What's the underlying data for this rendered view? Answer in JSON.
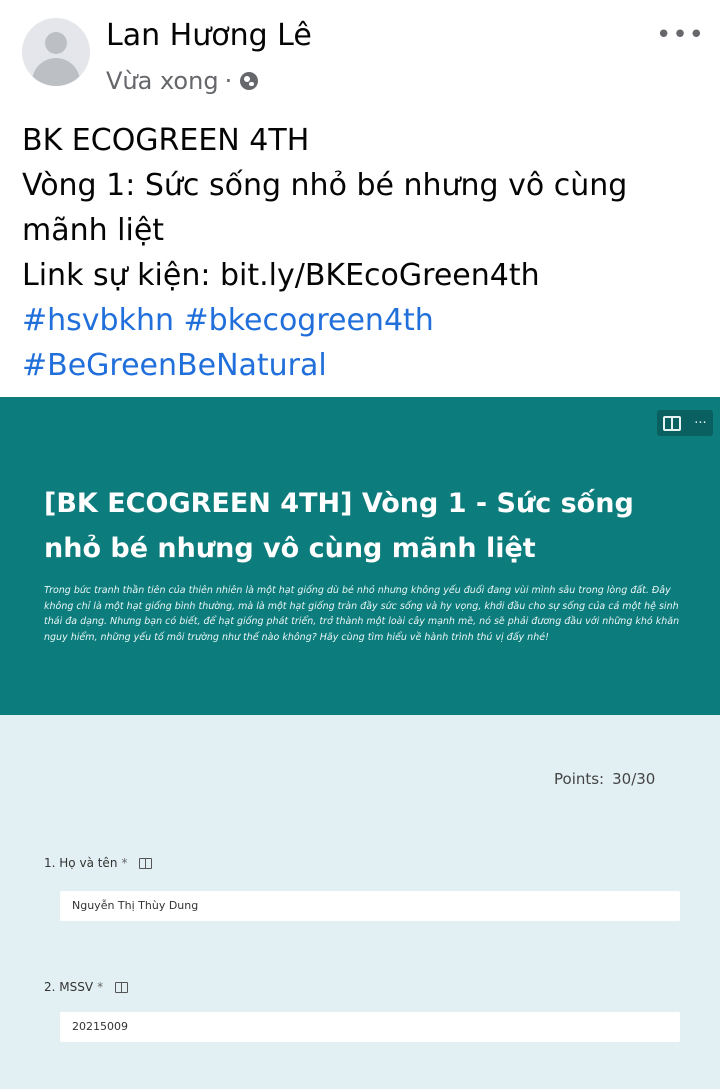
{
  "post": {
    "author": "Lan Hương Lê",
    "time": "Vừa xong",
    "separator": "·",
    "privacy_icon": "globe-icon",
    "more_icon": "ellipsis-icon",
    "more_label": "•••",
    "text_lines": [
      "BK ECOGREEN 4TH",
      "Vòng 1: Sức sống nhỏ bé nhưng vô cùng mãnh liệt",
      "Link sự kiện: bit.ly/BKEcoGreen4th"
    ],
    "hashtags_line1": "#hsvbkhn #bkecogreen4th",
    "hashtags_line2": "#BeGreenBeNatural",
    "hashtag_color": "#216fdb"
  },
  "form": {
    "banner_color": "#0d7c7c",
    "toolbar": {
      "reader_icon": "immersive-reader-icon",
      "more_label": "···"
    },
    "title": "[BK ECOGREEN 4TH] Vòng 1 - Sức sống nhỏ bé nhưng vô cùng mãnh liệt",
    "description": "Trong bức tranh thần tiên của thiên nhiên là một hạt giống dù bé nhỏ nhưng không yếu đuối đang vùi mình sâu trong lòng đất. Đây không chỉ là một hạt giống bình thường, mà là một hạt giống tràn đầy sức sống và hy vọng, khởi đầu cho sự sống của cả một hệ sinh thái đa dạng. Nhưng bạn có biết, để hạt giống phát triển, trở thành một loài cây mạnh mẽ, nó sẽ phải đương đầu với những khó khăn nguy hiểm, những yếu tố môi trường như thế nào không? Hãy cùng tìm hiểu về hành trình thú vị đấy nhé!",
    "points_label": "Points:",
    "points_value": "30/30",
    "questions": [
      {
        "number": "1.",
        "label": "Họ và tên",
        "required": "*",
        "answer": "Nguyễn Thị Thùy Dung"
      },
      {
        "number": "2.",
        "label": "MSSV",
        "required": "*",
        "answer": "20215009"
      }
    ]
  }
}
